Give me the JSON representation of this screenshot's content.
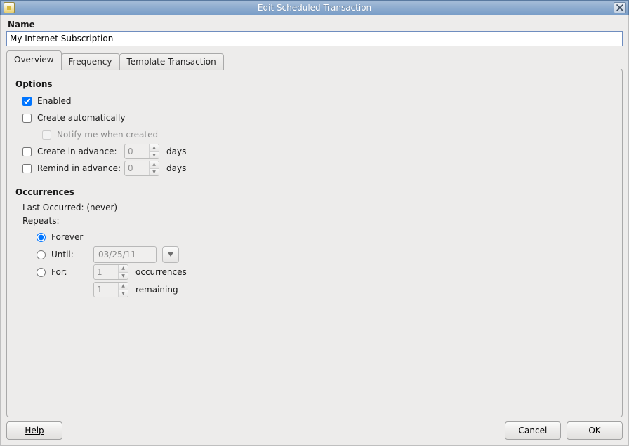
{
  "window": {
    "title": "Edit Scheduled Transaction"
  },
  "name": {
    "label": "Name",
    "value": "My Internet Subscription"
  },
  "tabs": {
    "overview": "Overview",
    "frequency": "Frequency",
    "template": "Template Transaction",
    "active": "overview"
  },
  "options": {
    "heading": "Options",
    "enabled": {
      "label": "Enabled",
      "checked": true
    },
    "create_auto": {
      "label": "Create automatically",
      "checked": false
    },
    "notify": {
      "label": "Notify me when created",
      "checked": false,
      "disabled": true
    },
    "create_in_advance": {
      "label": "Create in advance:",
      "checked": false,
      "value": "0",
      "unit": "days"
    },
    "remind_in_advance": {
      "label": "Remind in advance:",
      "checked": false,
      "value": "0",
      "unit": "days"
    }
  },
  "occurrences": {
    "heading": "Occurrences",
    "last_occurred_label": "Last Occurred: ",
    "last_occurred_value": "(never)",
    "repeats_label": "Repeats:",
    "forever": {
      "label": "Forever",
      "selected": true
    },
    "until": {
      "label": "Until:",
      "selected": false,
      "date": "03/25/11"
    },
    "for": {
      "label": "For:",
      "selected": false,
      "count": "1",
      "count_unit": "occurrences",
      "remaining": "1",
      "remaining_unit": "remaining"
    }
  },
  "buttons": {
    "help": "Help",
    "cancel": "Cancel",
    "ok": "OK"
  }
}
